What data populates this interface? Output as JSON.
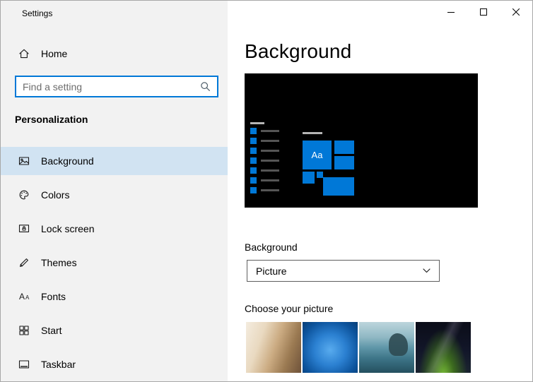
{
  "window": {
    "title": "Settings"
  },
  "titlebar": {
    "controls": [
      {
        "name": "minimize",
        "icon": "minimize-icon"
      },
      {
        "name": "maximize",
        "icon": "maximize-icon"
      },
      {
        "name": "close",
        "icon": "close-icon"
      }
    ]
  },
  "sidebar": {
    "home_label": "Home",
    "home_icon": "home-icon",
    "search": {
      "placeholder": "Find a setting",
      "icon": "search-icon"
    },
    "section_label": "Personalization",
    "items": [
      {
        "label": "Background",
        "icon": "background-icon",
        "selected": true
      },
      {
        "label": "Colors",
        "icon": "colors-icon",
        "selected": false
      },
      {
        "label": "Lock screen",
        "icon": "lock-screen-icon",
        "selected": false
      },
      {
        "label": "Themes",
        "icon": "themes-icon",
        "selected": false
      },
      {
        "label": "Fonts",
        "icon": "fonts-icon",
        "selected": false
      },
      {
        "label": "Start",
        "icon": "start-icon",
        "selected": false
      },
      {
        "label": "Taskbar",
        "icon": "taskbar-icon",
        "selected": false
      }
    ]
  },
  "main": {
    "title": "Background",
    "preview": {
      "tile_text": "Aa"
    },
    "background_section_label": "Background",
    "dropdown": {
      "value": "Picture",
      "icon": "chevron-down-icon"
    },
    "choose_label": "Choose your picture",
    "thumbnails": [
      {
        "name": "warm-interior"
      },
      {
        "name": "windows-default-blue"
      },
      {
        "name": "seaside-rocks"
      },
      {
        "name": "night-sky"
      }
    ]
  },
  "colors": {
    "accent": "#0078d7",
    "sidebar_bg": "#f2f2f2",
    "selected_item_bg": "#d1e3f2",
    "preview_bg": "#000000"
  }
}
